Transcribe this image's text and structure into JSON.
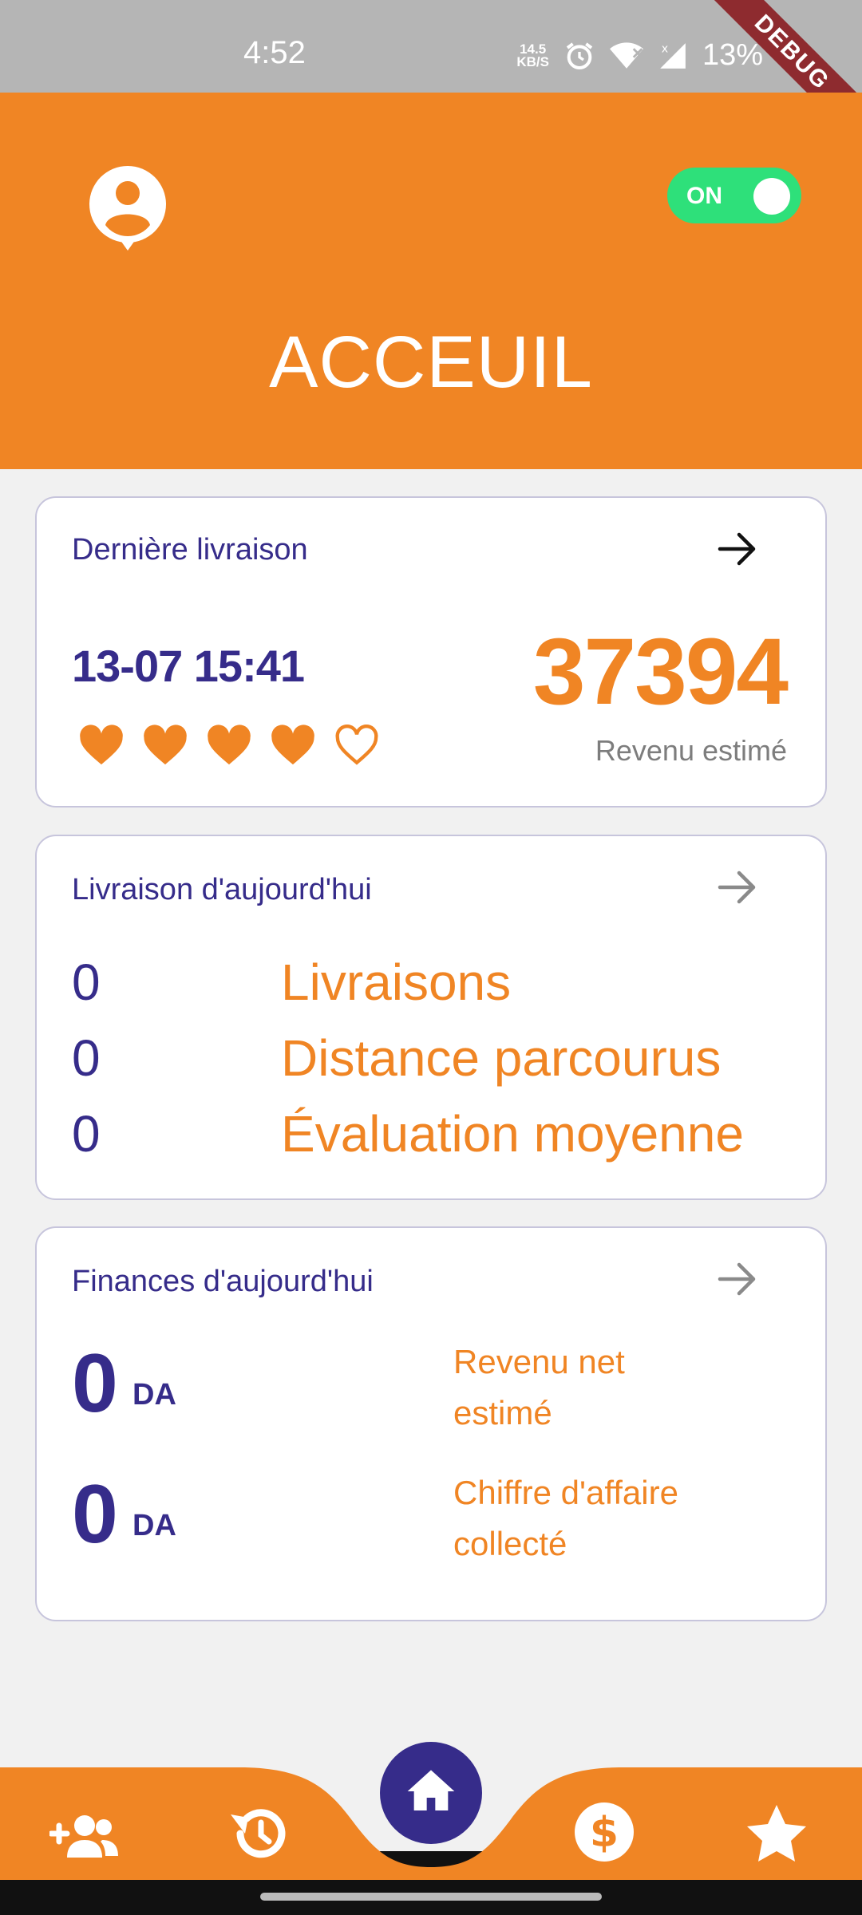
{
  "status_bar": {
    "time": "4:52",
    "net_speed_value": "14.5",
    "net_speed_unit": "KB/S",
    "battery": "13%",
    "debug_label": "DEBUG"
  },
  "header": {
    "title": "ACCEUIL",
    "toggle_label": "ON",
    "toggle_state": "on",
    "accent_color": "#f08524"
  },
  "last_delivery": {
    "title": "Dernière livraison",
    "datetime": "13-07 15:41",
    "rating": 4,
    "rating_max": 5,
    "revenue_value": "37394",
    "revenue_label": "Revenu estimé"
  },
  "today_deliveries": {
    "title": "Livraison d'aujourd'hui",
    "stats": [
      {
        "value": "0",
        "label": "Livraisons"
      },
      {
        "value": "0",
        "label": "Distance parcourus"
      },
      {
        "value": "0",
        "label": "Évaluation moyenne"
      }
    ]
  },
  "today_finances": {
    "title": "Finances d'aujourd'hui",
    "rows": [
      {
        "value": "0",
        "unit": "DA",
        "label_line1": "Revenu net",
        "label_line2": "estimé"
      },
      {
        "value": "0",
        "unit": "DA",
        "label_line1": "Chiffre d'affaire",
        "label_line2": "collecté"
      }
    ]
  },
  "bottom_nav": {
    "items": [
      {
        "icon": "add-user-icon"
      },
      {
        "icon": "history-icon"
      },
      {
        "icon": "home-icon",
        "active": true
      },
      {
        "icon": "dollar-icon"
      },
      {
        "icon": "star-icon"
      }
    ],
    "active_color": "#362c8a"
  }
}
